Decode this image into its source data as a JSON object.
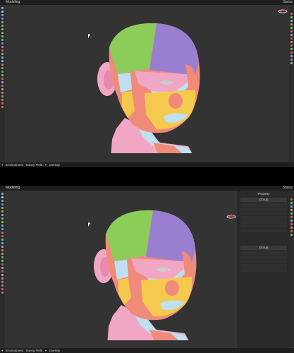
{
  "top_window": {
    "mode_label": "Modeling",
    "status_label": "Status",
    "bottom_bar": {
      "environment_label": "Environment",
      "environment_value": "Sunny Field",
      "overlay_label": "Overlay"
    }
  },
  "bottom_window": {
    "mode_label": "Modeling",
    "status_label": "Status",
    "side_panel": {
      "title": "Property",
      "group1": "Group",
      "group2": "Group"
    },
    "bottom_bar": {
      "environment_label": "Environment",
      "environment_value": "Sunny Field",
      "overlay_label": "Overlay"
    }
  },
  "icons": [
    "select-icon",
    "move-icon",
    "rotate-icon",
    "scale-icon",
    "brush-icon",
    "camera-icon",
    "light-icon",
    "navigation-gizmo-icon",
    "cursor-icon"
  ],
  "colors": {
    "background": "#333333",
    "bar": "#1e1e1e",
    "face_regions": [
      "#9a7fd0",
      "#8ccd5a",
      "#f08a7a",
      "#f5c94e",
      "#bfe0f0",
      "#f0a6c4"
    ]
  }
}
